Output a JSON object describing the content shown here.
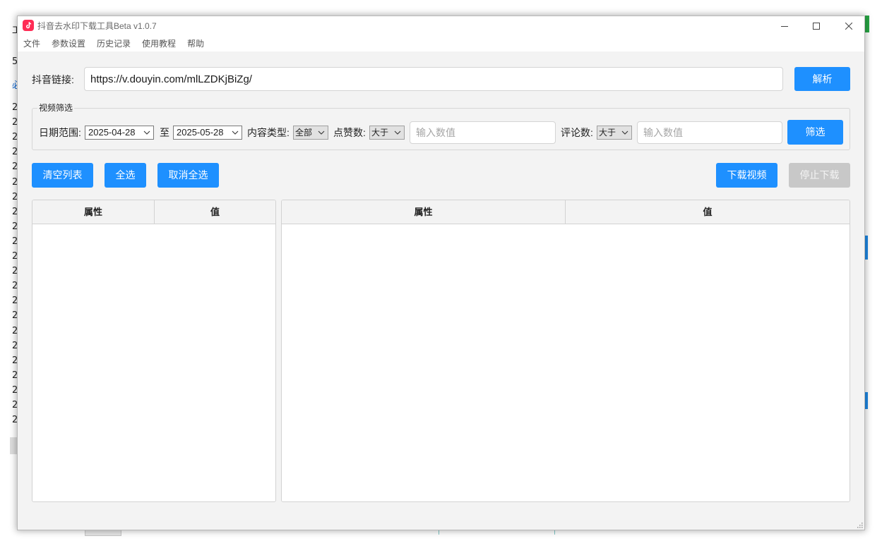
{
  "window": {
    "title": "抖音去水印下载工具Beta v1.0.7"
  },
  "menu": [
    "文件",
    "参数设置",
    "历史记录",
    "使用教程",
    "帮助"
  ],
  "link_row": {
    "label": "抖音链接:",
    "url_value": "https://v.douyin.com/mlLZDKjBiZg/",
    "parse_button": "解析"
  },
  "filter": {
    "group_title": "视频筛选",
    "date_range_label": "日期范围:",
    "date_from": "2025-04-28",
    "to_label": "至",
    "date_to": "2025-05-28",
    "content_type_label": "内容类型:",
    "content_type_value": "全部",
    "likes_label": "点赞数:",
    "likes_operator": "大于",
    "likes_placeholder": "输入数值",
    "comments_label": "评论数:",
    "comments_operator": "大于",
    "comments_placeholder": "输入数值",
    "filter_button": "筛选"
  },
  "actions": {
    "clear_list": "清空列表",
    "select_all": "全选",
    "deselect_all": "取消全选",
    "download_video": "下载视频",
    "stop_download": "停止下载",
    "stop_download_enabled": false
  },
  "left_table": {
    "columns": [
      "属性",
      "值"
    ]
  },
  "right_table": {
    "columns": [
      "属性",
      "值"
    ]
  },
  "icons": {
    "app": "tiktok-logo-icon",
    "minimize": "minimize-icon",
    "maximize": "maximize-icon",
    "close": "close-icon",
    "dropdown": "chevron-down-icon",
    "resize": "resize-grip-icon"
  },
  "colors": {
    "accent": "#1e90ff",
    "disabled_button": "#c8c8c8",
    "app_icon": "#fe2c55",
    "window_background": "#f3f3f3"
  },
  "background_window": {
    "edge_glyphs": [
      "工",
      "5",
      "必",
      "2",
      "2",
      "2",
      "2",
      "2",
      "2",
      "2",
      "2",
      "2",
      "2",
      "2",
      "2",
      "2",
      "2",
      "2",
      "2",
      "2",
      "2",
      "2",
      "2",
      "2",
      "2"
    ]
  }
}
